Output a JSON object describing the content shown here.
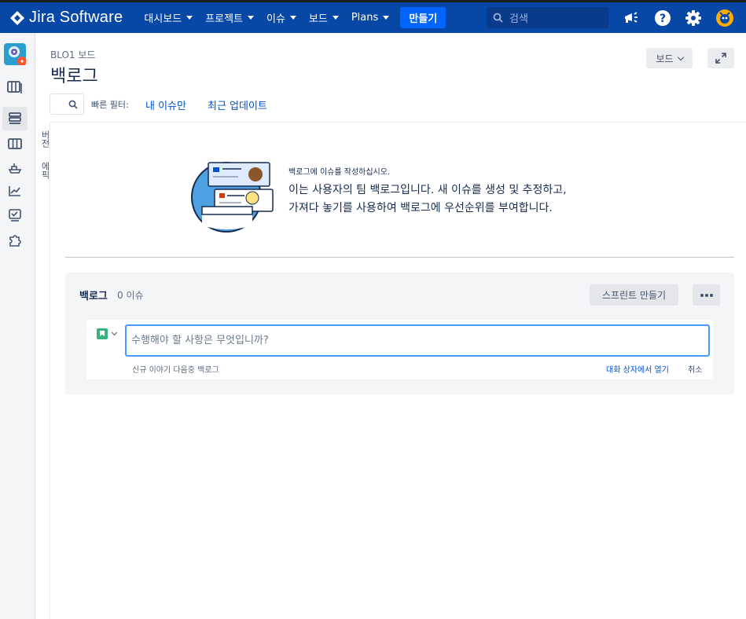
{
  "app": {
    "logo_text": "Jira Software"
  },
  "nav": {
    "items": [
      {
        "label": "대시보드"
      },
      {
        "label": "프로젝트"
      },
      {
        "label": "이슈"
      },
      {
        "label": "보드"
      },
      {
        "label": "Plans"
      }
    ],
    "create_label": "만들기",
    "search_placeholder": "검색"
  },
  "header": {
    "breadcrumb": "BLO1 보드",
    "title": "백로그",
    "board_button": "보드"
  },
  "filters": {
    "label": "빠른 필터:",
    "links": [
      "내 이슈만",
      "최근 업데이트"
    ]
  },
  "side_panel": {
    "labels": [
      "버전",
      "에픽"
    ]
  },
  "empty_state": {
    "title": "백로그에 이슈를 작성하십시오.",
    "line1": "이는 사용자의 팀 백로그입니다. 새 이슈를 생성 및 추정하고,",
    "line2": "가져다 놓기를 사용하여 백로그에 우선순위를 부여합니다."
  },
  "backlog": {
    "title": "백로그",
    "count": "0 이슈",
    "create_sprint": "스프린트 만들기",
    "input_placeholder": "수행해야 할 사항은 무엇입니까?",
    "hint": "신규 이야기 다음중 백로그",
    "open_dialog": "대화 상자에서 열기",
    "cancel": "취소"
  },
  "colors": {
    "nav_bg": "#0747a6",
    "create_btn": "#0065ff",
    "link": "#0052cc",
    "story": "#36b37e",
    "focus": "#4c9aff"
  }
}
